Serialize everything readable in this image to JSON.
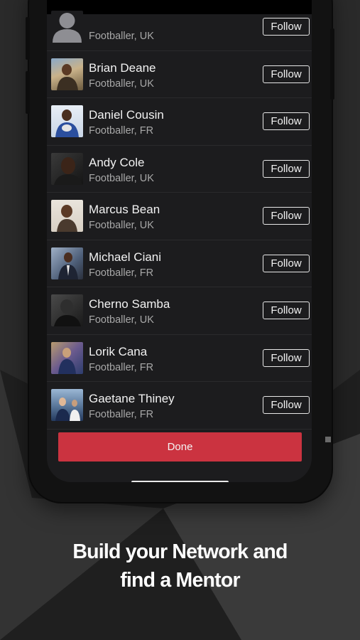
{
  "people": [
    {
      "name": "",
      "subtitle": "Footballer, UK",
      "avatar": "default-user-icon",
      "follow_label": "Follow"
    },
    {
      "name": "Brian Deane",
      "subtitle": "Footballer, UK",
      "avatar": "photo",
      "follow_label": "Follow"
    },
    {
      "name": "Daniel Cousin",
      "subtitle": "Footballer, FR",
      "avatar": "photo",
      "follow_label": "Follow"
    },
    {
      "name": "Andy Cole",
      "subtitle": "Footballer, UK",
      "avatar": "photo",
      "follow_label": "Follow"
    },
    {
      "name": "Marcus Bean",
      "subtitle": "Footballer, UK",
      "avatar": "photo",
      "follow_label": "Follow"
    },
    {
      "name": "Michael Ciani",
      "subtitle": "Footballer, FR",
      "avatar": "photo",
      "follow_label": "Follow"
    },
    {
      "name": "Cherno Samba",
      "subtitle": "Footballer, UK",
      "avatar": "photo",
      "follow_label": "Follow"
    },
    {
      "name": "Lorik Cana",
      "subtitle": "Footballer, FR",
      "avatar": "photo",
      "follow_label": "Follow"
    },
    {
      "name": "Gaetane Thiney",
      "subtitle": "Footballer, FR",
      "avatar": "photo",
      "follow_label": "Follow"
    }
  ],
  "done_label": "Done",
  "caption": {
    "line1": "Build your Network and",
    "line2": "find a Mentor"
  },
  "colors": {
    "background": "#2a2a2a",
    "screen": "#1c1c1e",
    "accent": "#cb3340"
  }
}
